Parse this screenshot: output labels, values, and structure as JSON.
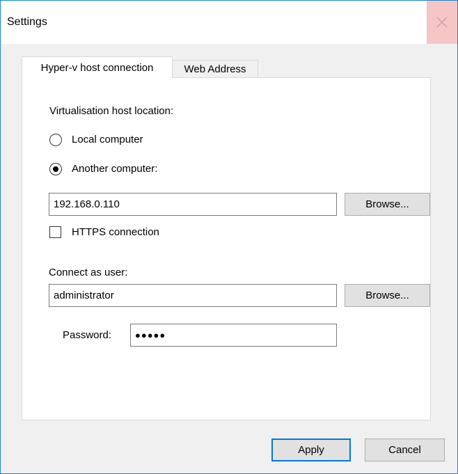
{
  "window": {
    "title": "Settings"
  },
  "tabs": [
    {
      "label": "Hyper-v host connection",
      "active": true
    },
    {
      "label": "Web Address",
      "active": false
    }
  ],
  "host_section": {
    "label": "Virtualisation host location:",
    "options": [
      {
        "label": "Local computer",
        "checked": false
      },
      {
        "label": "Another computer:",
        "checked": true
      }
    ],
    "address_value": "192.168.0.110",
    "browse_label": "Browse...",
    "https_label": "HTTPS connection",
    "https_checked": false
  },
  "user_section": {
    "label": "Connect as user:",
    "user_value": "administrator",
    "browse_label": "Browse...",
    "password_label": "Password:",
    "password_value": "●●●●●"
  },
  "footer": {
    "apply_label": "Apply",
    "cancel_label": "Cancel"
  },
  "colors": {
    "accent": "#0078d7",
    "close_hover": "#f4c6c6"
  }
}
